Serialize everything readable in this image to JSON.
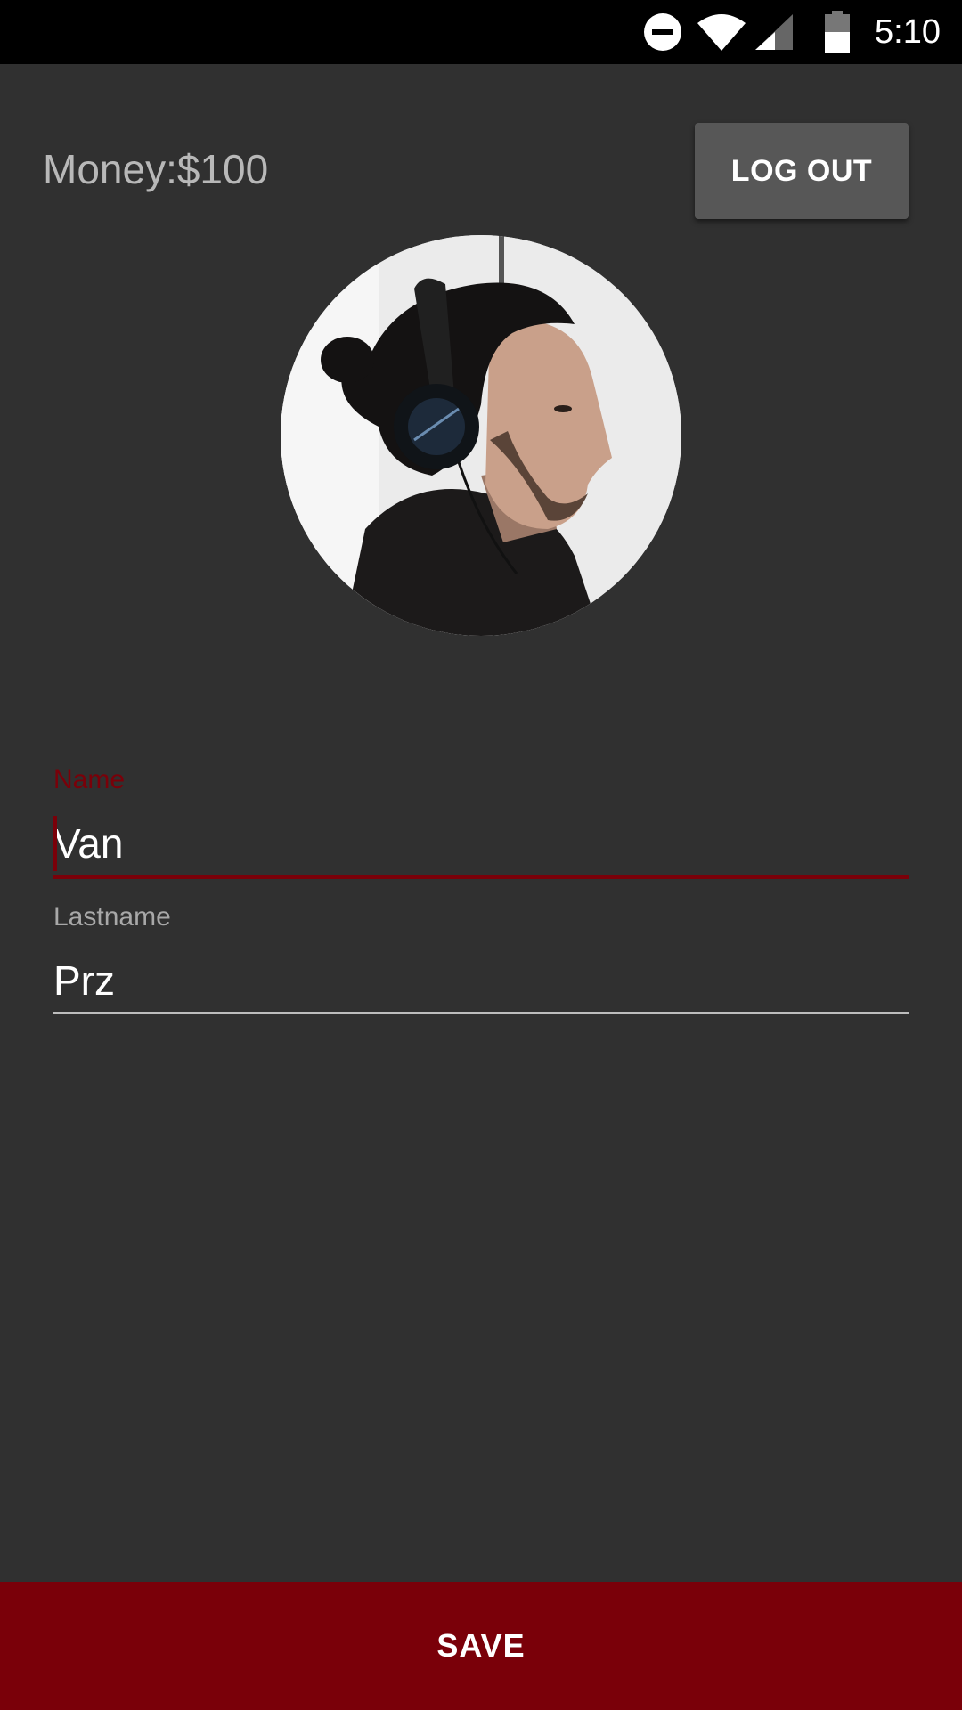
{
  "status_bar": {
    "time": "5:10",
    "icons": [
      "do-not-disturb-icon",
      "wifi-icon",
      "cell-signal-icon",
      "battery-icon"
    ]
  },
  "header": {
    "money": "Money:$100",
    "logout_label": "LOG OUT"
  },
  "profile": {
    "avatar": "profile-photo"
  },
  "form": {
    "name_label": "Name",
    "name_value": "Van",
    "lastname_label": "Lastname",
    "lastname_value": "Prz"
  },
  "footer": {
    "save_label": "SAVE"
  },
  "colors": {
    "background": "#303030",
    "accent": "#7a0009",
    "status_bar": "#000000",
    "button_gray": "#575757"
  }
}
